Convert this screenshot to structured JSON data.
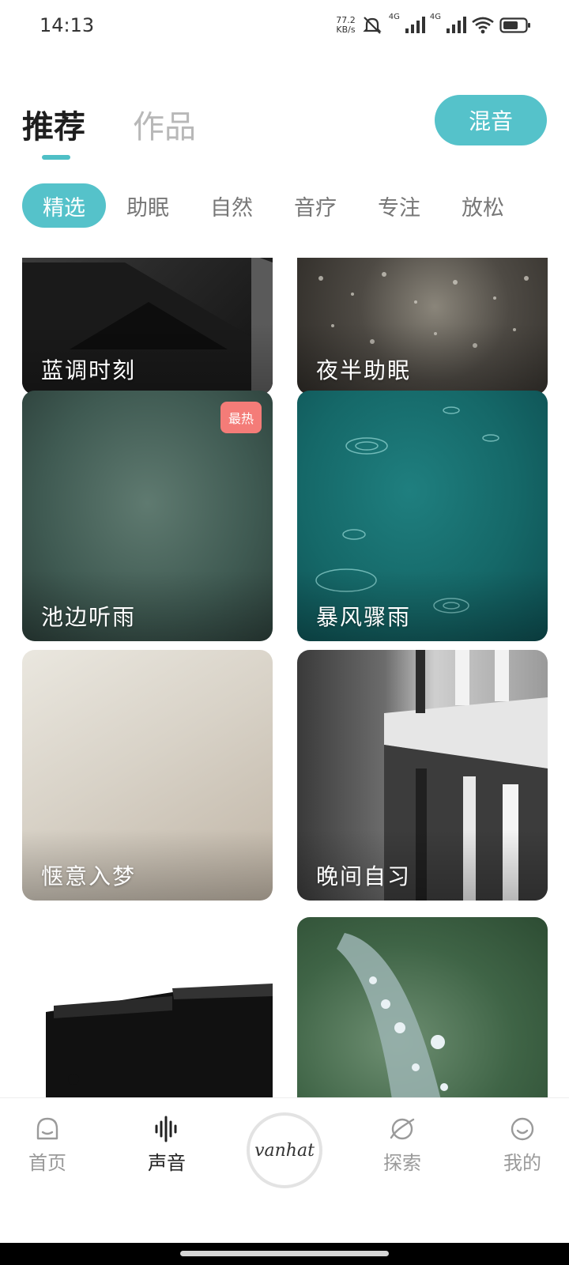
{
  "status_bar": {
    "time": "14:13",
    "net_speed_value": "77.2",
    "net_speed_unit": "KB/s",
    "signal_1": "4G",
    "signal_2": "4G",
    "wifi_level": "6"
  },
  "header": {
    "tab_active": "推荐",
    "tab_inactive": "作品",
    "mix_button": "混音"
  },
  "categories": [
    "精选",
    "助眠",
    "自然",
    "音疗",
    "专注",
    "放松"
  ],
  "cards": [
    {
      "title": "蓝调时刻"
    },
    {
      "title": "夜半助眠"
    },
    {
      "title": "池边听雨",
      "badge": "最热"
    },
    {
      "title": "暴风骤雨"
    },
    {
      "title": "惬意入梦"
    },
    {
      "title": "晚间自习"
    },
    {
      "title": ""
    },
    {
      "title": ""
    }
  ],
  "bottom_nav": {
    "home": "首页",
    "sound": "声音",
    "logo": "vanhat",
    "explore": "探索",
    "mine": "我的"
  },
  "colors": {
    "accent": "#55c2ca",
    "badge": "#f47c78"
  }
}
